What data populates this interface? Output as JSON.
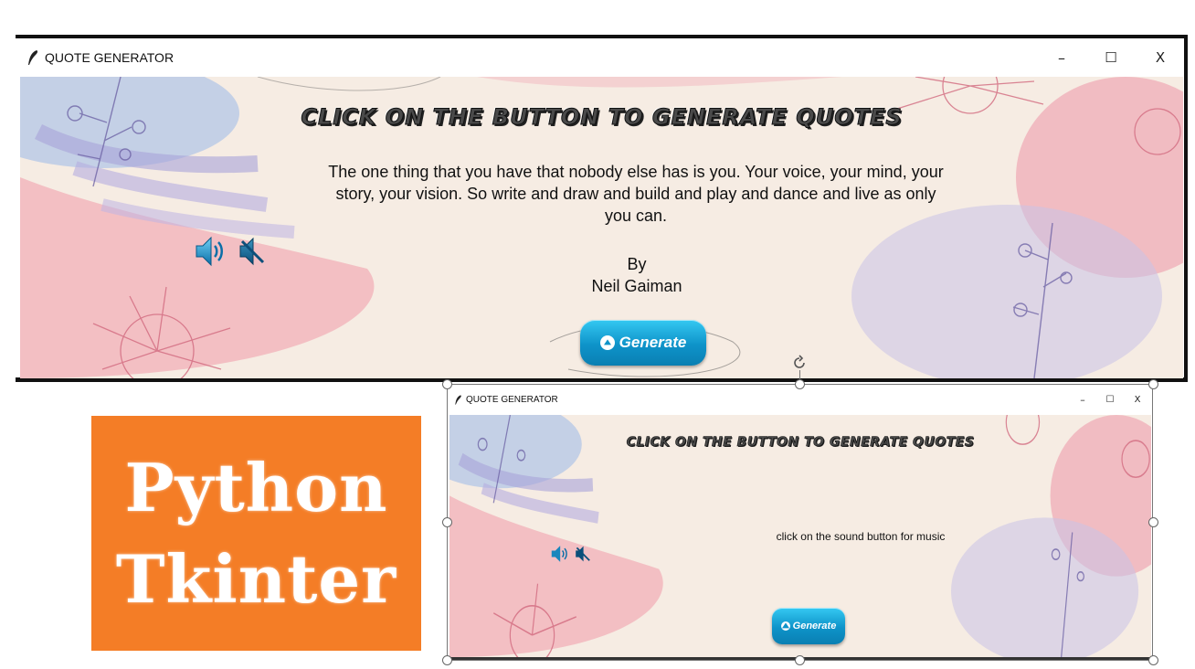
{
  "window_main": {
    "title": "QUOTE GENERATOR",
    "minimize": "–",
    "maximize": "☐",
    "close": "X",
    "banner": "CLICK ON THE BUTTON TO GENERATE QUOTES",
    "quote": "The one thing that you have that nobody else has is you. Your voice, your mind, your story, your vision. So write and draw and build and play and dance and live as only you can.",
    "by_label": "By",
    "author": "Neil Gaiman",
    "generate_label": "Generate",
    "icons": [
      "sound-on-icon",
      "sound-off-icon",
      "feather-icon",
      "up-arrow-icon"
    ]
  },
  "window_preview": {
    "title": "QUOTE GENERATOR",
    "minimize": "–",
    "maximize": "☐",
    "close": "X",
    "banner": "CLICK ON THE BUTTON TO GENERATE QUOTES",
    "message": "click on the sound button for music",
    "generate_label": "Generate"
  },
  "logo_card": {
    "line1": "Python",
    "line2": "Tkinter"
  },
  "colors": {
    "accent_button": "#0e93c9",
    "logo_background": "#f47d26",
    "canvas_background": "#f6ece3"
  }
}
